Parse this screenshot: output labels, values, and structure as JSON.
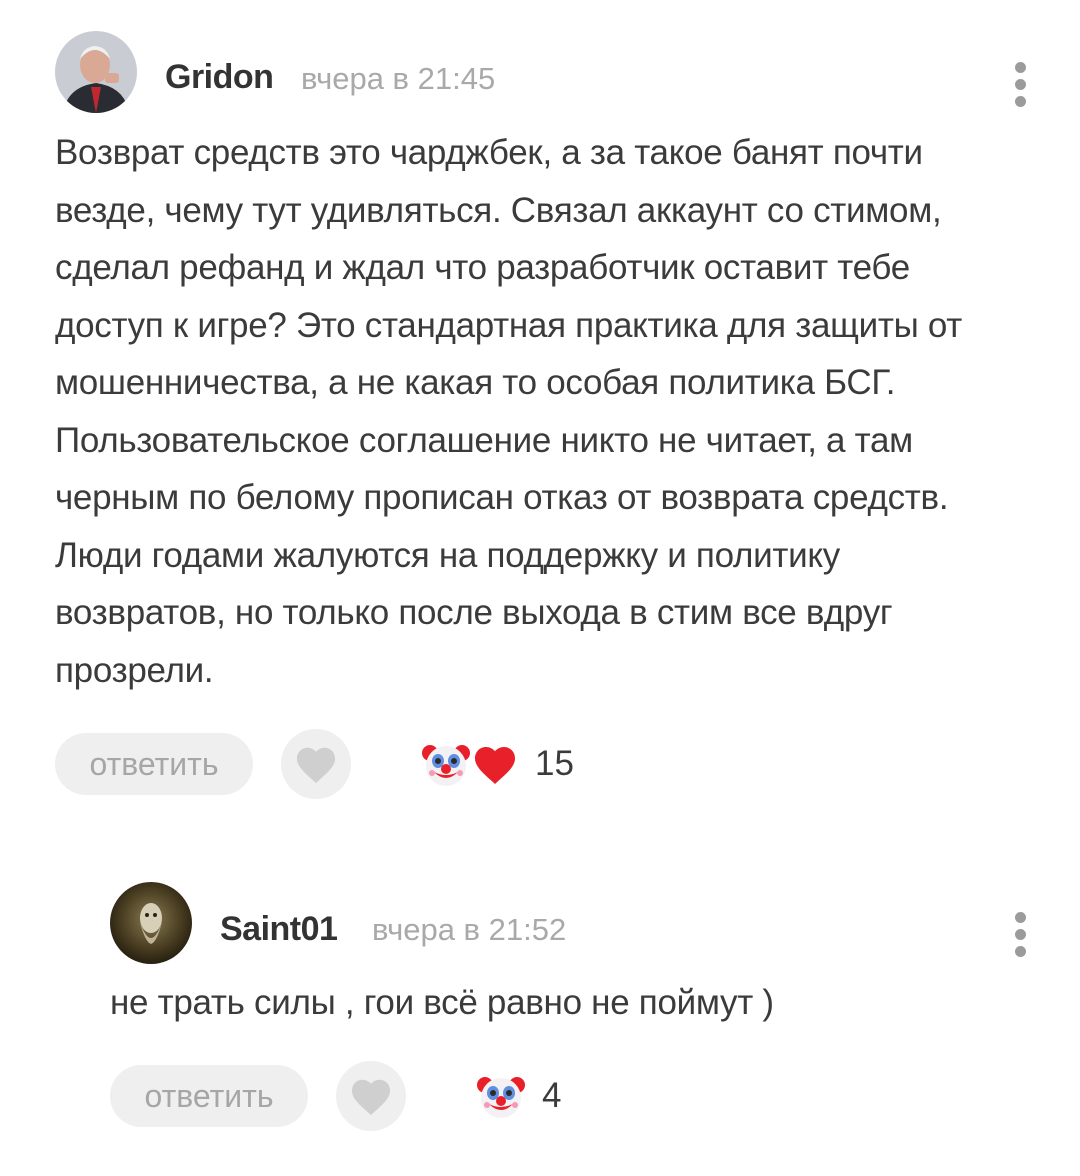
{
  "comments": [
    {
      "author": "Gridon",
      "time": "вчера в 21:45",
      "text": "Возврат средств это чарджбек, а за такое банят почти везде, чему тут удивляться. Связал аккаунт со стимом, сделал рефанд и ждал что разработчик оставит тебе доступ к игре? Это стандартная практика для защиты от мошенничества, а не какая то особая политика БСГ. Пользовательское соглашение никто не читает, а там черным по белому прописан отказ от возврата средств. Люди годами жалуются на поддержку и политику возвратов, но только после выхода в стим все вдруг прозрели.",
      "reply_label": "ответить",
      "reactions": [
        "clown-emoji",
        "red-heart-emoji"
      ],
      "reaction_count": "15"
    },
    {
      "author": "Saint01",
      "time": "вчера в 21:52",
      "text": "не трать силы , гои всё равно не поймут )",
      "reply_label": "ответить",
      "reactions": [
        "clown-emoji"
      ],
      "reaction_count": "4"
    }
  ],
  "colors": {
    "text": "#3b3b3b",
    "meta": "#a9a9a9",
    "button_bg": "#efefef",
    "heart": "#e8202a"
  }
}
